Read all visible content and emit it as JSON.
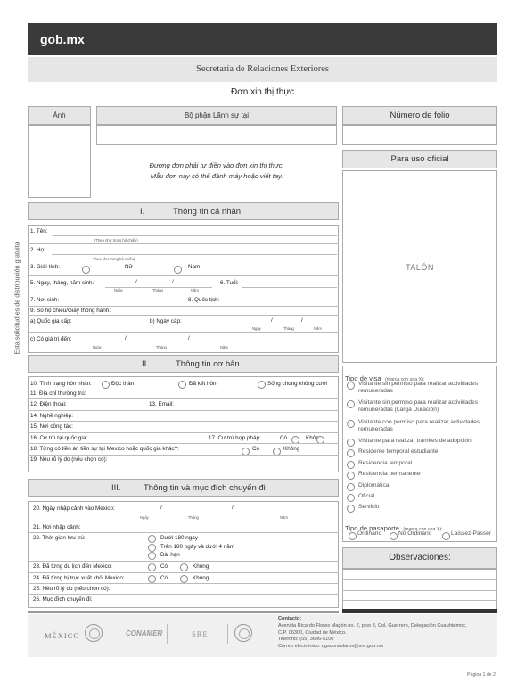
{
  "header": {
    "logo": "gob.mx"
  },
  "banner": "Secretaría de Relaciones Exteriores",
  "form_title": "Đơn xin thị thực",
  "photo_label": "Ảnh",
  "consulate_label": "Bộ phận Lãnh sự tại",
  "folio_label": "Número de folio",
  "official_use_label": "Para uso oficial",
  "instructions": [
    "Đương đơn phải tự điền vào đơn xin thị thực.",
    "Mẫu đơn này có thể đánh máy hoặc viết tay."
  ],
  "talon": "TALÓN",
  "side_text": "Esta solicitud es de distribución gratuita",
  "section1": {
    "roman": "I.",
    "title": "Thông tin cá nhân",
    "name": "1. Tên:",
    "name_hint": "(Theo như trong hộ chiếu)",
    "surname": "2. Họ:",
    "surname_hint": "Theo như trong hộ chiếu)",
    "gender": "3. Giới tính:",
    "female": "Nữ",
    "male": "Nam",
    "dob": "5. Ngày, tháng, năm sinh:",
    "age": "6. Tuổi:",
    "dob_day": "Ngày",
    "dob_month": "Tháng",
    "dob_year": "Năm",
    "pob": "7. Nơi sinh:",
    "nationality": "8. Quốc tịch:",
    "passport": "9. Số hộ chiếu/Giấy thông hành:",
    "issuing_country": "a) Quốc gia cấp:",
    "issue_date": "b) Ngày cấp:",
    "expiry": "c) Có giá trị đến:",
    "issue_day": "Ngày",
    "issue_month": "Tháng",
    "issue_year": "Năm",
    "exp_day": "Ngày",
    "exp_month": "Tháng",
    "exp_year": "Năm"
  },
  "section2": {
    "roman": "II.",
    "title": "Thông tin cơ bản",
    "marital": "10. Tình trạng hôn nhân:",
    "single": "Độc thân",
    "married": "Đã kết hôn",
    "cohabit": "Sống chung không cưới",
    "address": "11. Địa chỉ thường trú:",
    "phone": "12. Điện thoại:",
    "email": "13. Email:",
    "occupation": "14. Nghề nghiệp:",
    "workplace": "15. Nơi công tác:",
    "residence": "16. Cư trú tại quốc gia:",
    "legal_res": "17. Cư trú hợp pháp:",
    "yes": "Có",
    "no": "Không",
    "criminal": "18. Từng có tiền án tiền sự tại Mexico hoặc quốc gia khác?:",
    "criminal_yes": "Có",
    "criminal_no": "Không",
    "reason": "19. Nêu rõ lý do (nếu chọn có):"
  },
  "section3": {
    "roman": "III.",
    "title": "Thông tin và mục đích chuyến đi",
    "entry": "20. Ngày nhập cảnh vào Mexico:",
    "entry_day": "Ngày",
    "entry_month": "Tháng",
    "entry_year": "Năm",
    "port": "21. Nơi nhập cảnh:",
    "stay": "22. Thời gian lưu trú:",
    "stay_opts": [
      "Dưới 180 ngày",
      "Trên 180 ngày và dưới 4 năm",
      "Dài hạn"
    ],
    "travel": "23. Đã từng du lịch đến Mexico:",
    "deport": "24. Đã từng bị trục xuất khỏi Mexico:",
    "yes": "Có",
    "no": "Không",
    "reason": "25. Nêu rõ lý do (nếu chọn có):",
    "purpose": "26. Mục đích chuyến đi:"
  },
  "visa": {
    "title": "Tipo de visa",
    "hint": "(marca con una X):",
    "options": [
      "Visitante sin permiso para realizar actividades remuneradas",
      "Visitante sin permiso para realizar actividades remuneradas (Larga Duración)",
      "Visitante con permiso para realizar actividades remuneradas",
      "Visitante para realizar trámites de adopción",
      "Residente temporal estudiante",
      "Residencia temporal",
      "Residencia permanente",
      "Diplomática",
      "Oficial",
      "Servicio"
    ]
  },
  "passport_type": {
    "title": "Tipo de pasaporte",
    "hint": "(marca con una X):",
    "options": [
      "Ordinario",
      "No Ordinario",
      "Laissez-Passer"
    ]
  },
  "observations": "Observaciones:",
  "footer": {
    "logos": [
      "MÉXICO",
      "CONAMER",
      "SRE"
    ],
    "contact_title": "Contacto:",
    "contact_lines": [
      "Avenida Ricardo Flores Magón no. 2, piso 3, Col. Guerrero, Delegación Cuauhtémoc,",
      "C.P. 06300, Ciudad de México.",
      "Teléfono: (55) 3686-5100",
      "Correo electrónico: dgsconsulares@sre.gob.mx"
    ],
    "page": "Página 1 de 2"
  },
  "colors": {
    "header_bg": "#3a3a3a",
    "section_bg": "#e6e6e6",
    "border": "#aaaaaa"
  }
}
